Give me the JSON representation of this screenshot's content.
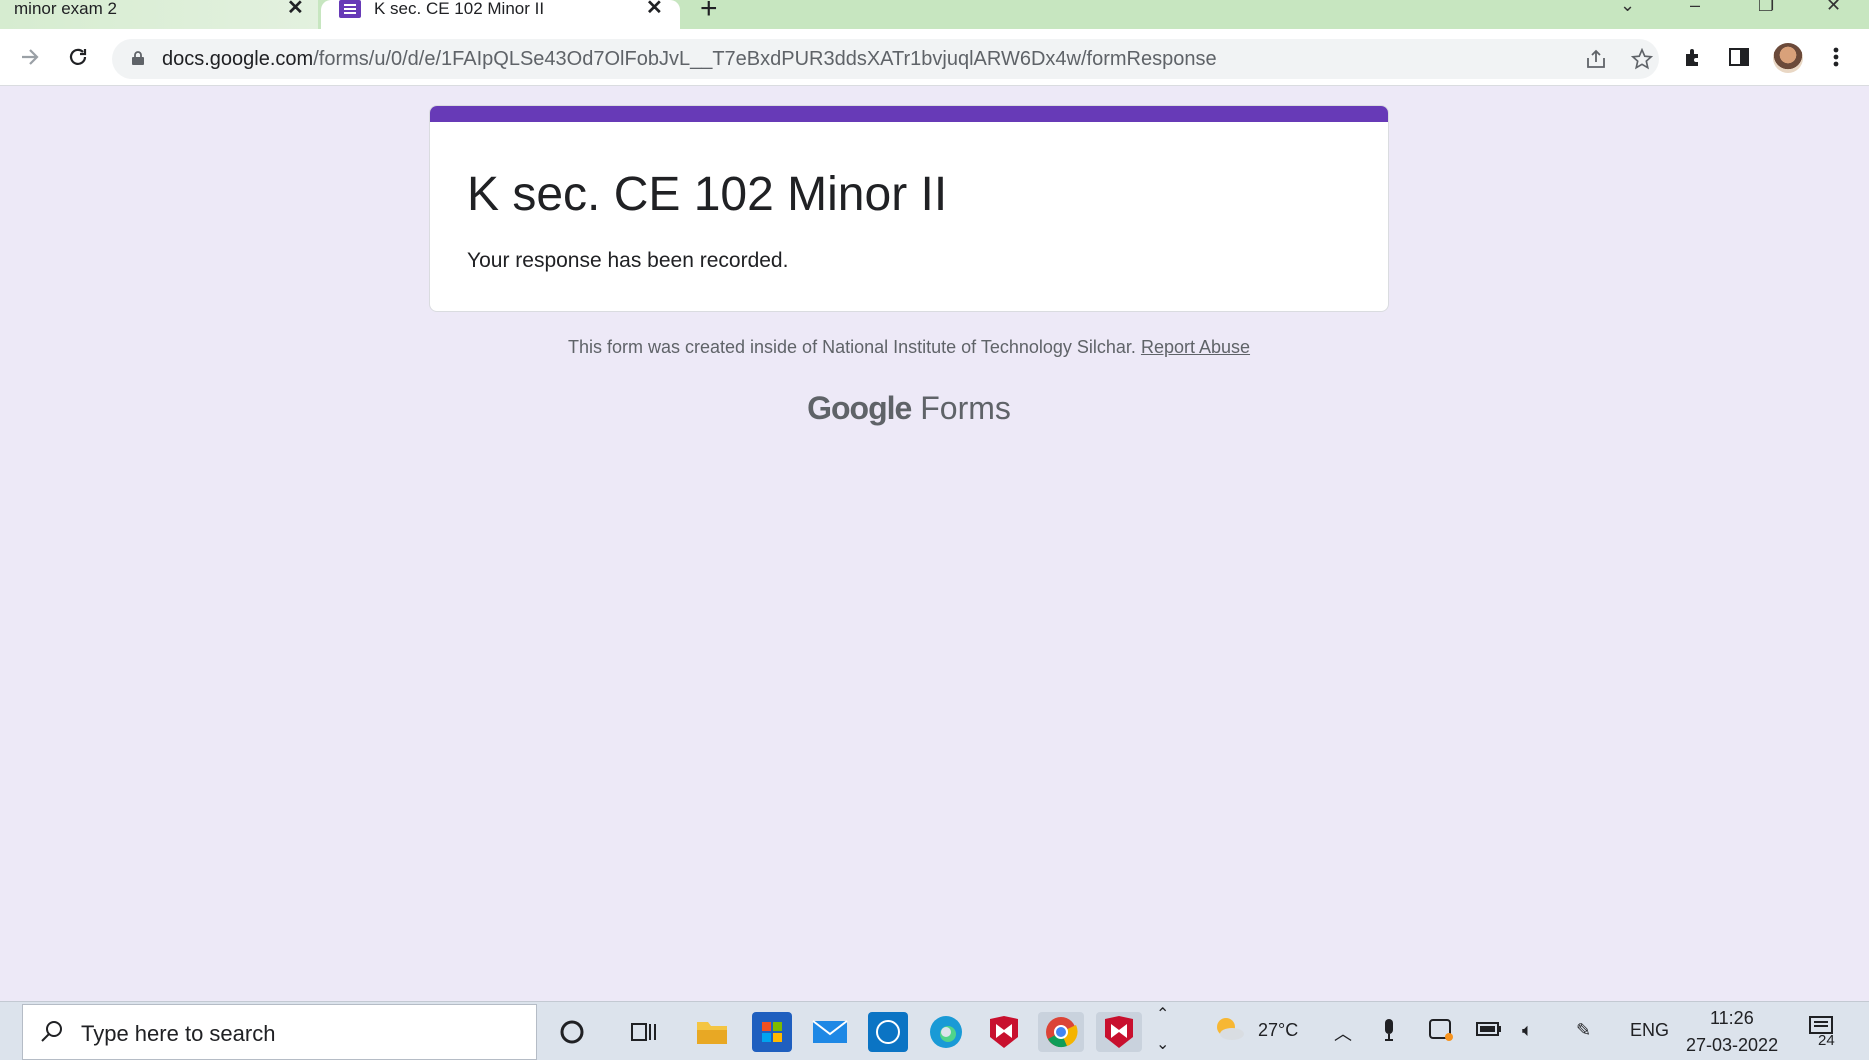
{
  "browser": {
    "tabs": [
      {
        "label": "minor exam 2"
      },
      {
        "label": "K sec. CE 102 Minor II"
      }
    ],
    "address": {
      "host": "docs.google.com",
      "path": "/forms/u/0/d/e/1FAIpQLSe43Od7OlFobJvL__T7eBxdPUR3ddsXATr1bvjuqlARW6Dx4w/formResponse"
    }
  },
  "form": {
    "title": "K sec. CE 102 Minor II",
    "confirmation": "Your response has been recorded.",
    "footer_text": "This form was created inside of National Institute of Technology Silchar.",
    "report_link": "Report Abuse",
    "brand_google": "Google",
    "brand_forms": "Forms",
    "accent_color": "#673ab7"
  },
  "taskbar": {
    "search_placeholder": "Type here to search",
    "weather": "27°C",
    "language": "ENG",
    "time": "11:26",
    "date": "27-03-2022",
    "notifications": "24"
  }
}
